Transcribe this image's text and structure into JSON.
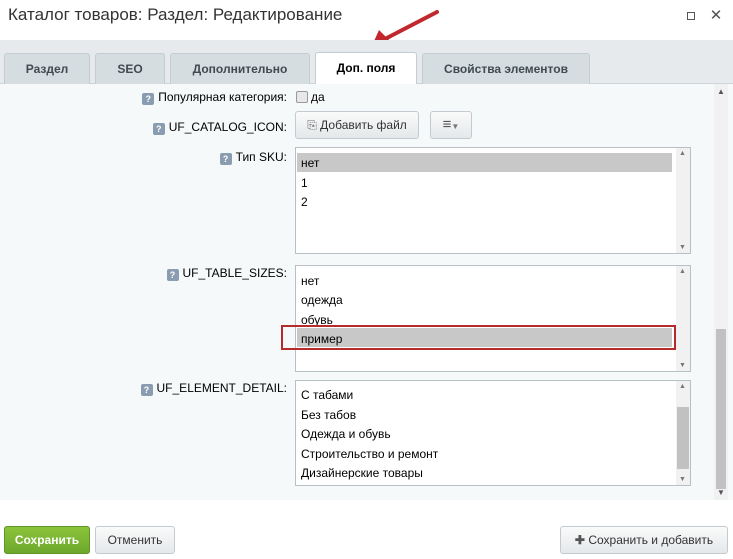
{
  "window": {
    "title": "Каталог товаров: Раздел: Редактирование"
  },
  "tabs": [
    {
      "label": "Раздел"
    },
    {
      "label": "SEO"
    },
    {
      "label": "Дополнительно"
    },
    {
      "label": "Доп. поля",
      "active": true
    },
    {
      "label": "Свойства элементов"
    }
  ],
  "fields": {
    "popular": {
      "label": "Популярная категория:",
      "checkbox_label": "да",
      "checked": false
    },
    "catalog_icon": {
      "label": "UF_CATALOG_ICON:",
      "add_file_label": "Добавить файл"
    },
    "sku_type": {
      "label": "Тип SKU:",
      "options": [
        "нет",
        "1",
        "2"
      ],
      "selected": "нет"
    },
    "table_sizes": {
      "label": "UF_TABLE_SIZES:",
      "options": [
        "нет",
        "одежда",
        "обувь",
        "пример"
      ],
      "selected": "пример"
    },
    "element_detail": {
      "label": "UF_ELEMENT_DETAIL:",
      "options": [
        "С табами",
        "Без табов",
        "Одежда и обувь",
        "Строительство и ремонт",
        "Дизайнерские товары"
      ]
    }
  },
  "footer": {
    "save_label": "Сохранить",
    "cancel_label": "Отменить",
    "save_add_label": "Сохранить и добавить"
  },
  "colors": {
    "accent_green": "#7ab735",
    "annotation_red": "#b52a2a"
  }
}
